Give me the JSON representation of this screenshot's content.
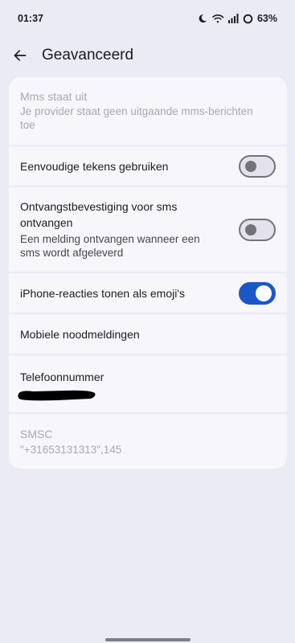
{
  "status_bar": {
    "time": "01:37",
    "battery_percent": "63%",
    "icons": [
      "moon-icon",
      "wifi-icon",
      "signal-icon",
      "battery-ring-icon"
    ]
  },
  "header": {
    "back_icon": "arrow-back-icon",
    "title": "Geavanceerd"
  },
  "settings": {
    "mms": {
      "title": "Mms staat uit",
      "subtitle": "Je provider staat geen uitgaande mms-berichten toe",
      "enabled": false
    },
    "simple_chars": {
      "title": "Eenvoudige tekens gebruiken",
      "checked": false
    },
    "delivery_reports": {
      "title": "Ontvangstbevestiging voor sms ontvangen",
      "subtitle": "Een melding ontvangen wanneer een sms wordt afgeleverd",
      "checked": false
    },
    "iphone_reactions": {
      "title": "iPhone-reacties tonen als emoji's",
      "checked": true
    },
    "emergency_alerts": {
      "title": "Mobiele noodmeldingen"
    },
    "phone_number": {
      "title": "Telefoonnummer"
    },
    "smsc": {
      "title": "SMSC",
      "value": "\"+31653131313\",145",
      "enabled": false
    }
  },
  "colors": {
    "background": "#ebebf5",
    "card": "#f7f6fb",
    "accent": "#1a57c9",
    "text": "#1c1b20",
    "disabled_text": "#a9a8b1"
  }
}
